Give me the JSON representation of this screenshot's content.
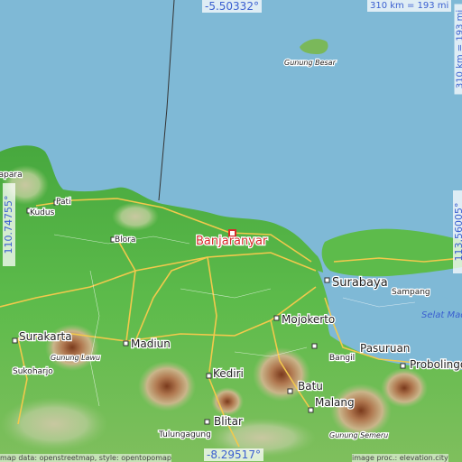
{
  "map": {
    "highlight_place": "Banjaranyar",
    "places": [
      {
        "id": "gunung-besar",
        "label": "Gunung Besar"
      },
      {
        "id": "japara",
        "label": "Japara"
      },
      {
        "id": "pati",
        "label": "Pati"
      },
      {
        "id": "kudus",
        "label": "Kudus"
      },
      {
        "id": "blora",
        "label": "Blora"
      },
      {
        "id": "surabaya",
        "label": "Surabaya"
      },
      {
        "id": "sampang",
        "label": "Sampang"
      },
      {
        "id": "mojokerto",
        "label": "Mojokerto"
      },
      {
        "id": "surakarta",
        "label": "Surakarta"
      },
      {
        "id": "madiun",
        "label": "Madiun"
      },
      {
        "id": "gunung-lawu",
        "label": "Gunung Lawu"
      },
      {
        "id": "sukoharjo",
        "label": "Sukoharjo"
      },
      {
        "id": "kediri",
        "label": "Kediri"
      },
      {
        "id": "pasuruan",
        "label": "Pasuruan"
      },
      {
        "id": "bangil",
        "label": "Bangil"
      },
      {
        "id": "probolinggo",
        "label": "Probolingo"
      },
      {
        "id": "batu",
        "label": "Batu"
      },
      {
        "id": "malang",
        "label": "Malang"
      },
      {
        "id": "blitar",
        "label": "Blitar"
      },
      {
        "id": "tulungagung",
        "label": "Tulungagung"
      },
      {
        "id": "gunung-semeru",
        "label": "Gunung Semeru"
      },
      {
        "id": "selat-madura",
        "label": "Selat Mad"
      }
    ],
    "coordinates": {
      "top": "-5.50332°",
      "bottom": "-8.29517°",
      "left": "110.74755°",
      "right": "113.56005°"
    },
    "scale": {
      "horizontal": "310 km = 193 mi",
      "vertical": "310 km = 193 mi"
    },
    "credits": {
      "left": "map data: openstreetmap, style: opentopomap",
      "right": "image proc.: elevation.city"
    },
    "colors": {
      "sea": "#7fb9d6",
      "lowland": "#58b94a",
      "hills": "#a8c47a",
      "mountain": "#9a5a36",
      "road": "#f2c94c",
      "marker": "#d62b2b",
      "coord_text": "#3a5fd0"
    }
  }
}
